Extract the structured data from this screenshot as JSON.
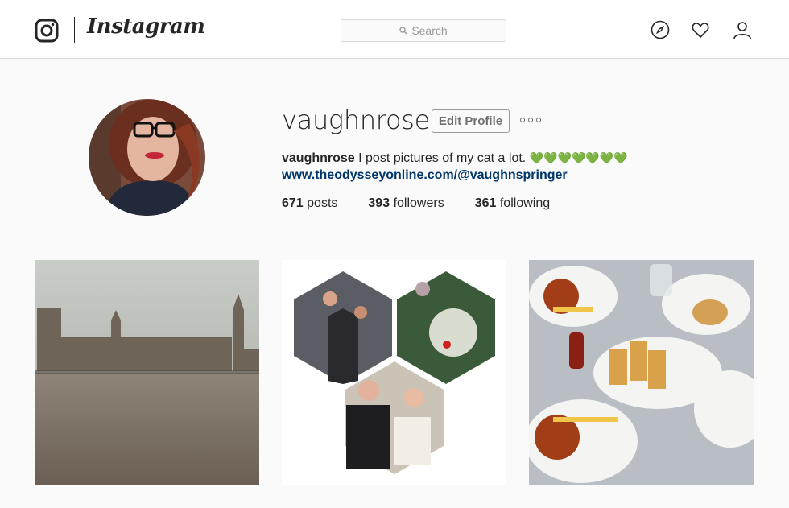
{
  "header": {
    "wordmark": "Instagram",
    "search_placeholder": "Search",
    "icons": [
      "instagram-logo-icon",
      "search-icon",
      "compass-icon",
      "heart-icon",
      "profile-icon"
    ]
  },
  "profile": {
    "username": "vaughnrose",
    "edit_label": "Edit Profile",
    "full_name": "vaughnrose",
    "bio_text": "I post pictures of my cat a lot.",
    "bio_emoji": "💚💚💚💚💚💚💚",
    "website": "www.theodysseyonline.com/@vaughnspringer",
    "posts_count": "671",
    "posts_label": "posts",
    "followers_count": "393",
    "followers_label": "followers",
    "following_count": "361",
    "following_label": "following"
  },
  "posts": [
    {
      "subject": "big-ben-parliament-photo"
    },
    {
      "subject": "hexagon-collage-photo"
    },
    {
      "subject": "breakfast-table-photo"
    }
  ],
  "colors": {
    "link": "#003569",
    "border": "#dbdbdb",
    "background": "#fafafa",
    "emoji_heart": "#44c830"
  }
}
